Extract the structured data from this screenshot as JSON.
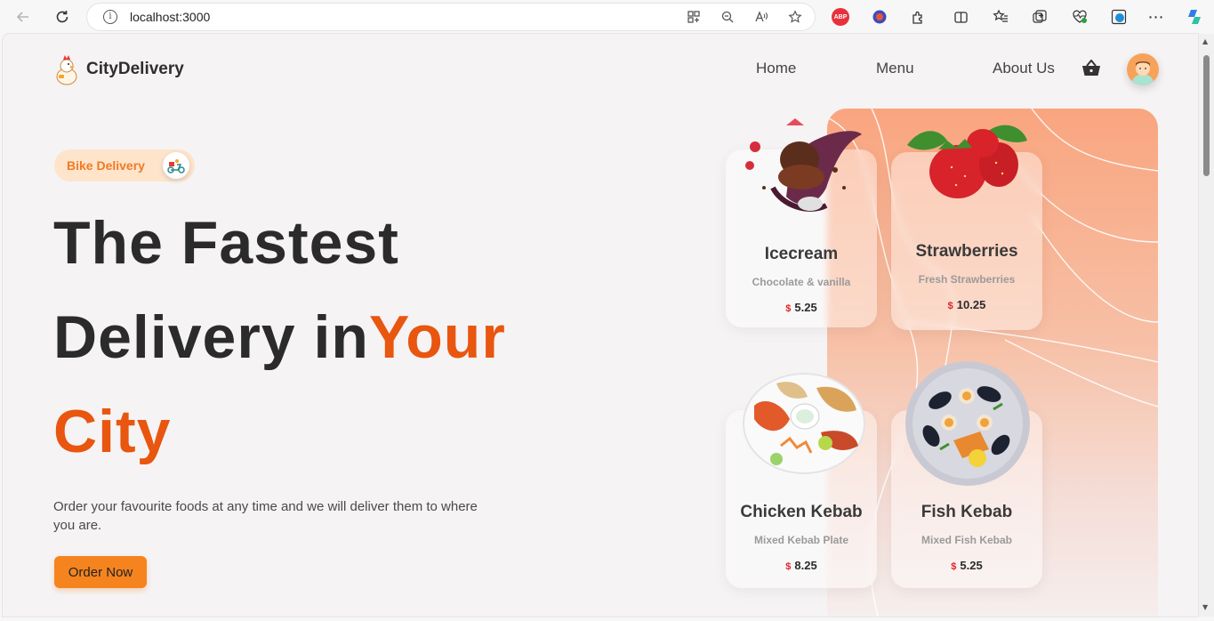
{
  "browser": {
    "url": "localhost:3000"
  },
  "header": {
    "brand": "CityDelivery",
    "nav": [
      "Home",
      "Menu",
      "About Us"
    ]
  },
  "hero": {
    "badge": "Bike Delivery",
    "line1": "The Fastest",
    "line2_plain": "Delivery in",
    "line2_accent": "Your",
    "line3_accent": "City",
    "description": "Order your favourite foods at any time and we will deliver them to where you are.",
    "cta": "Order Now"
  },
  "cards": [
    {
      "name": "Icecream",
      "subtitle": "Chocolate & vanilla",
      "currency": "$",
      "price": "5.25",
      "image_icon": "icecream-icon"
    },
    {
      "name": "Strawberries",
      "subtitle": "Fresh Strawberries",
      "currency": "$",
      "price": "10.25",
      "image_icon": "strawberry-icon"
    },
    {
      "name": "Chicken Kebab",
      "subtitle": "Mixed Kebab Plate",
      "currency": "$",
      "price": "8.25",
      "image_icon": "kebab-plate-icon"
    },
    {
      "name": "Fish Kebab",
      "subtitle": "Mixed Fish Kebab",
      "currency": "$",
      "price": "5.25",
      "image_icon": "seafood-plate-icon"
    }
  ],
  "colors": {
    "accent": "#e8560f",
    "cta": "#f5841f",
    "badge_bg": "#fde4cb",
    "price_currency": "#e02424"
  }
}
